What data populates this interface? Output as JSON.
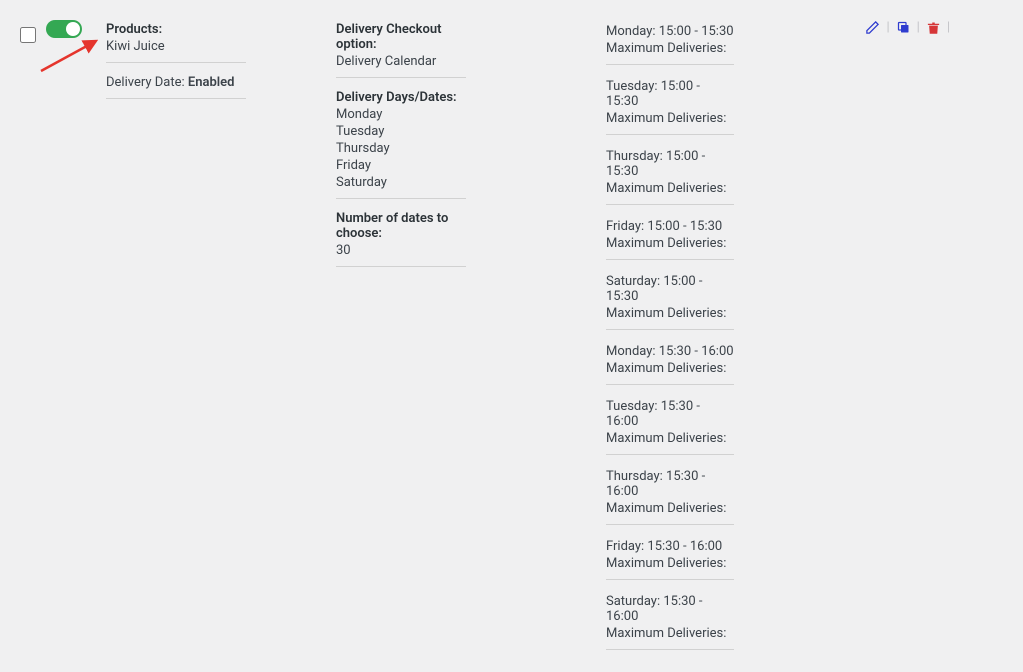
{
  "row": {
    "products": {
      "label": "Products:",
      "value": "Kiwi Juice"
    },
    "delivery_date": {
      "label": "Delivery Date:",
      "value": "Enabled"
    },
    "checkout_option": {
      "label": "Delivery Checkout option:",
      "value": "Delivery Calendar"
    },
    "delivery_days": {
      "label": "Delivery Days/Dates:",
      "items": [
        "Monday",
        "Tuesday",
        "Thursday",
        "Friday",
        "Saturday"
      ]
    },
    "num_dates": {
      "label": "Number of dates to choose:",
      "value": "30"
    },
    "slots": [
      {
        "line1": "Monday: 15:00 - 15:30",
        "line2": "Maximum Deliveries:"
      },
      {
        "line1": "Tuesday: 15:00 - 15:30",
        "line2": "Maximum Deliveries:"
      },
      {
        "line1": "Thursday: 15:00 - 15:30",
        "line2": "Maximum Deliveries:"
      },
      {
        "line1": "Friday: 15:00 - 15:30",
        "line2": "Maximum Deliveries:"
      },
      {
        "line1": "Saturday: 15:00 - 15:30",
        "line2": "Maximum Deliveries:"
      },
      {
        "line1": "Monday: 15:30 - 16:00",
        "line2": "Maximum Deliveries:"
      },
      {
        "line1": "Tuesday: 15:30 - 16:00",
        "line2": "Maximum Deliveries:"
      },
      {
        "line1": "Thursday: 15:30 - 16:00",
        "line2": "Maximum Deliveries:"
      },
      {
        "line1": "Friday: 15:30 - 16:00",
        "line2": "Maximum Deliveries:"
      },
      {
        "line1": "Saturday: 15:30 - 16:00",
        "line2": "Maximum Deliveries:"
      }
    ]
  }
}
